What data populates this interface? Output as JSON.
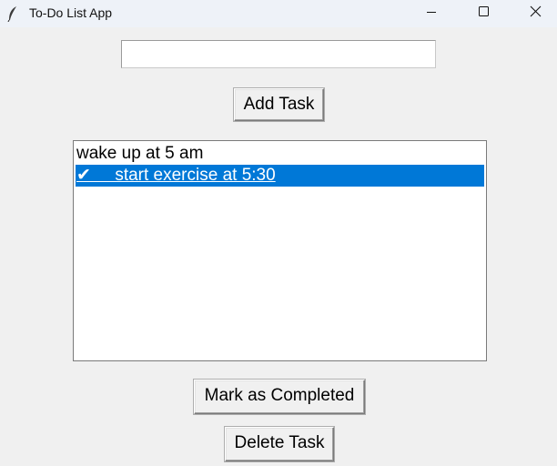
{
  "window": {
    "title": "To-Do List App",
    "icons": [
      "feather-icon",
      "minimize-icon",
      "maximize-icon",
      "close-icon"
    ]
  },
  "entry": {
    "value": "",
    "placeholder": ""
  },
  "buttons": {
    "add": "Add Task",
    "complete": "Mark as Completed",
    "delete": "Delete Task"
  },
  "tasks": [
    {
      "text": "wake up at 5 am",
      "selected": false
    },
    {
      "text": "✔     start exercise at 5:30",
      "selected": true
    }
  ],
  "colors": {
    "window_bg": "#f0f0f0",
    "titlebar_bg": "#eef2f8",
    "selection": "#0078d7"
  }
}
